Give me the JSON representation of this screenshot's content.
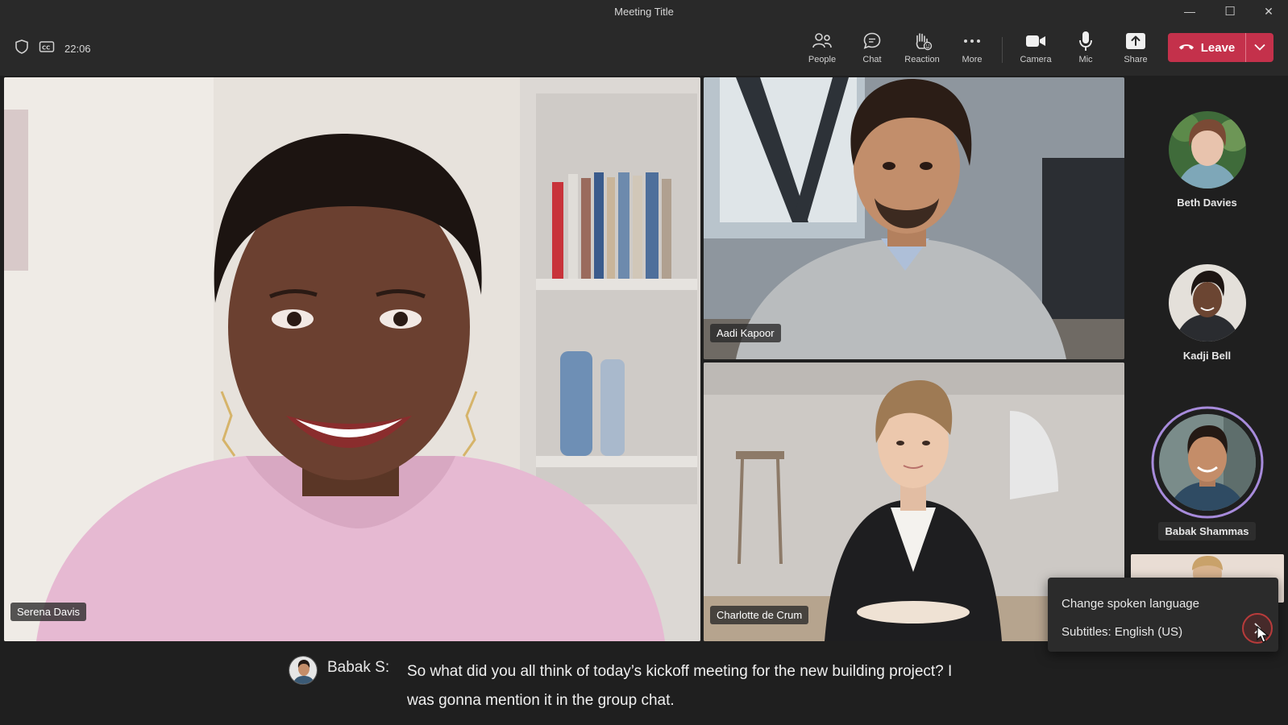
{
  "window": {
    "title": "Meeting Title",
    "minimize": "—",
    "maximize": "☐",
    "close": "✕"
  },
  "toolbar": {
    "time": "22:06",
    "buttons": {
      "people": "People",
      "chat": "Chat",
      "reaction": "Reaction",
      "more": "More",
      "camera": "Camera",
      "mic": "Mic",
      "share": "Share"
    },
    "leave_label": "Leave"
  },
  "participants": {
    "main": "Serena Davis",
    "top_right": "Aadi Kapoor",
    "bottom_right": "Charlotte de Crum"
  },
  "rail": {
    "people": [
      "Beth Davies",
      "Kadji Bell",
      "Babak Shammas"
    ]
  },
  "captions": {
    "speaker": "Babak S:",
    "text": "So what did you all think of today’s kickoff meeting for the new building project? I was gonna mention it in the group chat."
  },
  "popup": {
    "items": [
      "Change spoken language",
      "Subtitles: English (US)"
    ]
  },
  "colors": {
    "leave": "#c4314b",
    "speaking_ring": "#a78bdb",
    "toolbar_bg": "#292929"
  }
}
